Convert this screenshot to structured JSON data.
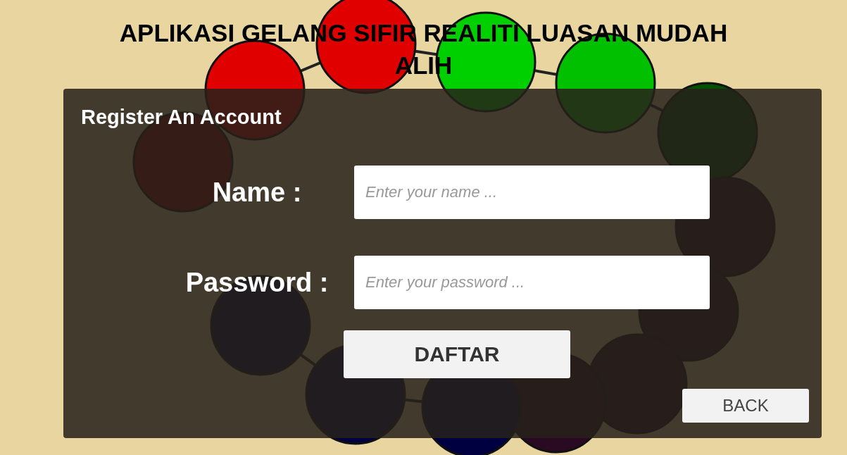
{
  "title": "APLIKASI GELANG SIFIR REALITI LUASAN MUDAH ALIH",
  "panel": {
    "heading": "Register An Account",
    "fields": [
      {
        "label": "Name :",
        "placeholder": "Enter your name ..."
      },
      {
        "label": "Password :",
        "placeholder": "Enter your password ..."
      }
    ],
    "submit_button": "DAFTAR",
    "back_button": "BACK"
  }
}
